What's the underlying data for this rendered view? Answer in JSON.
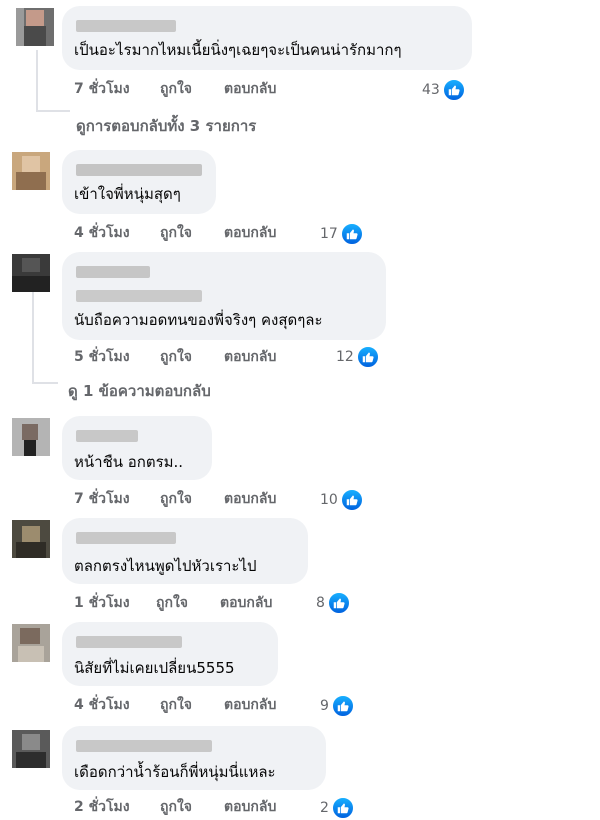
{
  "comments": [
    {
      "text": "เป็นอะไรมากไหมเนี้ยนิ่งๆเฉยๆจะเป็นคนน่ารักมากๆ",
      "time": "7 ชั่วโมง",
      "like": "ถูกใจ",
      "reply": "ตอบกลับ",
      "count": "43"
    },
    {
      "text": "เข้าใจพี่หนุ่มสุดๆ",
      "time": "4 ชั่วโมง",
      "like": "ถูกใจ",
      "reply": "ตอบกลับ",
      "count": "17"
    },
    {
      "text": "นับถือความอดทนของพี่จริงๆ คงสุดๆละ",
      "time": "5 ชั่วโมง",
      "like": "ถูกใจ",
      "reply": "ตอบกลับ",
      "count": "12"
    },
    {
      "text": "หน้าชืน อกตรม..",
      "time": "7 ชั่วโมง",
      "like": "ถูกใจ",
      "reply": "ตอบกลับ",
      "count": "10"
    },
    {
      "text": "ตลกตรงไหนพูดไปหัวเราะไป",
      "time": "1 ชั่วโมง",
      "like": "ถูกใจ",
      "reply": "ตอบกลับ",
      "count": "8"
    },
    {
      "text": "นิสัยที่ไม่เคยเปลี่ยน5555",
      "time": "4 ชั่วโมง",
      "like": "ถูกใจ",
      "reply": "ตอบกลับ",
      "count": "9"
    },
    {
      "text": "เดือดกว่าน้ำร้อนก็พี่หนุ่มนี่แหละ",
      "time": "2 ชั่วโมง",
      "like": "ถูกใจ",
      "reply": "ตอบกลับ",
      "count": "2"
    }
  ],
  "view_replies": {
    "first": "ดูการตอบกลับทั้ง 3 รายการ",
    "third": "ดู 1 ข้อความตอบกลับ"
  },
  "icons": {
    "like": "like-thumb-icon"
  },
  "colors": {
    "bubble": "#f0f2f5",
    "meta": "#65676b",
    "like_blue": "#0866ff"
  }
}
